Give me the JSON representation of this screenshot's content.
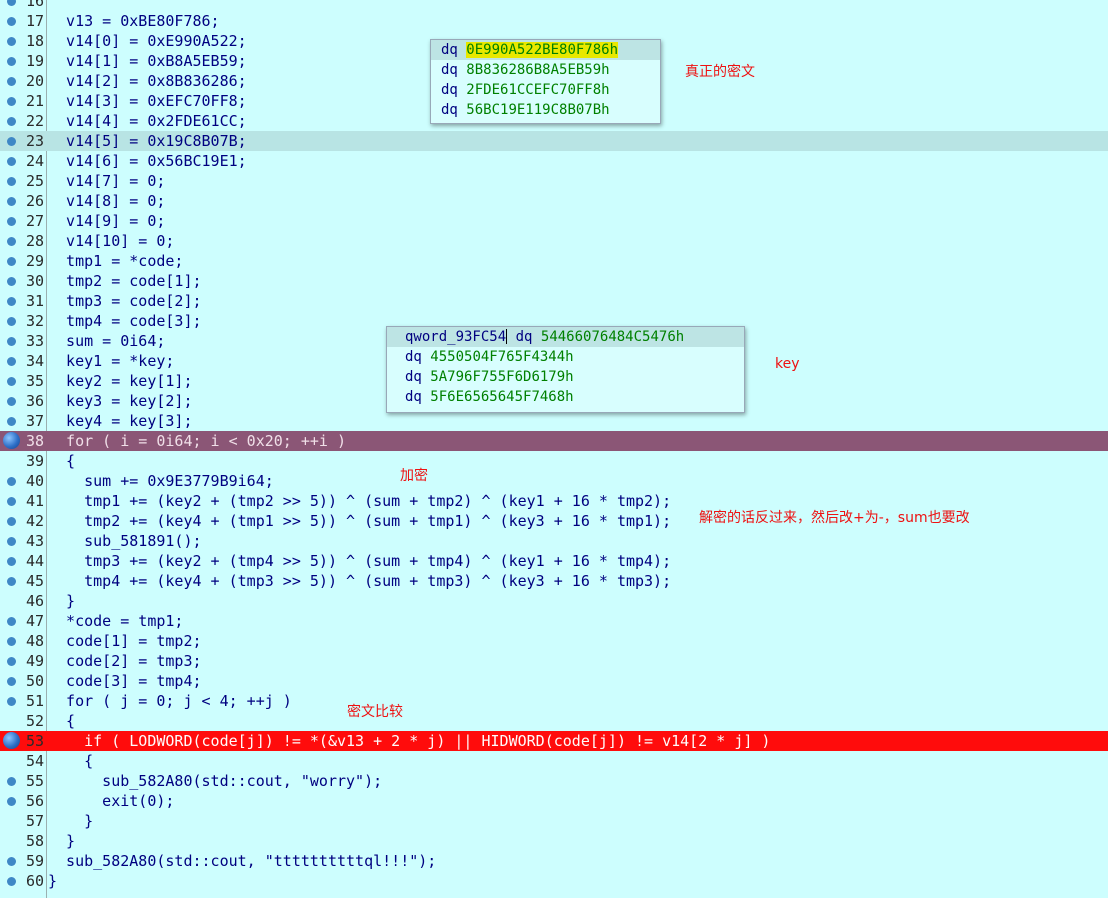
{
  "code_lines": [
    {
      "no": "16",
      "text": "",
      "marker": "dot",
      "hl": ""
    },
    {
      "no": "17",
      "text": "  v13 = 0xBE80F786;",
      "marker": "dot",
      "hl": ""
    },
    {
      "no": "18",
      "text": "  v14[0] = 0xE990A522;",
      "marker": "dot",
      "hl": ""
    },
    {
      "no": "19",
      "text": "  v14[1] = 0xB8A5EB59;",
      "marker": "dot",
      "hl": ""
    },
    {
      "no": "20",
      "text": "  v14[2] = 0x8B836286;",
      "marker": "dot",
      "hl": ""
    },
    {
      "no": "21",
      "text": "  v14[3] = 0xEFC70FF8;",
      "marker": "dot",
      "hl": ""
    },
    {
      "no": "22",
      "text": "  v14[4] = 0x2FDE61CC;",
      "marker": "dot",
      "hl": ""
    },
    {
      "no": "23",
      "text": "  v14[5] = 0x19C8B07B;",
      "marker": "dot",
      "hl": "cur"
    },
    {
      "no": "24",
      "text": "  v14[6] = 0x56BC19E1;",
      "marker": "dot",
      "hl": ""
    },
    {
      "no": "25",
      "text": "  v14[7] = 0;",
      "marker": "dot",
      "hl": ""
    },
    {
      "no": "26",
      "text": "  v14[8] = 0;",
      "marker": "dot",
      "hl": ""
    },
    {
      "no": "27",
      "text": "  v14[9] = 0;",
      "marker": "dot",
      "hl": ""
    },
    {
      "no": "28",
      "text": "  v14[10] = 0;",
      "marker": "dot",
      "hl": ""
    },
    {
      "no": "29",
      "text": "  tmp1 = *code;",
      "marker": "dot",
      "hl": ""
    },
    {
      "no": "30",
      "text": "  tmp2 = code[1];",
      "marker": "dot",
      "hl": ""
    },
    {
      "no": "31",
      "text": "  tmp3 = code[2];",
      "marker": "dot",
      "hl": ""
    },
    {
      "no": "32",
      "text": "  tmp4 = code[3];",
      "marker": "dot",
      "hl": ""
    },
    {
      "no": "33",
      "text": "  sum = 0i64;",
      "marker": "dot",
      "hl": ""
    },
    {
      "no": "34",
      "text": "  key1 = *key;",
      "marker": "dot",
      "hl": ""
    },
    {
      "no": "35",
      "text": "  key2 = key[1];",
      "marker": "dot",
      "hl": ""
    },
    {
      "no": "36",
      "text": "  key3 = key[2];",
      "marker": "dot",
      "hl": ""
    },
    {
      "no": "37",
      "text": "  key4 = key[3];",
      "marker": "dot",
      "hl": ""
    },
    {
      "no": "38",
      "text": "  for ( i = 0i64; i < 0x20; ++i )",
      "marker": "bp",
      "hl": "bp1"
    },
    {
      "no": "39",
      "text": "  {",
      "marker": "",
      "hl": ""
    },
    {
      "no": "40",
      "text": "    sum += 0x9E3779B9i64;",
      "marker": "dot",
      "hl": ""
    },
    {
      "no": "41",
      "text": "    tmp1 += (key2 + (tmp2 >> 5)) ^ (sum + tmp2) ^ (key1 + 16 * tmp2);",
      "marker": "dot",
      "hl": ""
    },
    {
      "no": "42",
      "text": "    tmp2 += (key4 + (tmp1 >> 5)) ^ (sum + tmp1) ^ (key3 + 16 * tmp1);",
      "marker": "dot",
      "hl": ""
    },
    {
      "no": "43",
      "text": "    sub_581891();",
      "marker": "dot",
      "hl": ""
    },
    {
      "no": "44",
      "text": "    tmp3 += (key2 + (tmp4 >> 5)) ^ (sum + tmp4) ^ (key1 + 16 * tmp4);",
      "marker": "dot",
      "hl": ""
    },
    {
      "no": "45",
      "text": "    tmp4 += (key4 + (tmp3 >> 5)) ^ (sum + tmp3) ^ (key3 + 16 * tmp3);",
      "marker": "dot",
      "hl": ""
    },
    {
      "no": "46",
      "text": "  }",
      "marker": "",
      "hl": ""
    },
    {
      "no": "47",
      "text": "  *code = tmp1;",
      "marker": "dot",
      "hl": ""
    },
    {
      "no": "48",
      "text": "  code[1] = tmp2;",
      "marker": "dot",
      "hl": ""
    },
    {
      "no": "49",
      "text": "  code[2] = tmp3;",
      "marker": "dot",
      "hl": ""
    },
    {
      "no": "50",
      "text": "  code[3] = tmp4;",
      "marker": "dot",
      "hl": ""
    },
    {
      "no": "51",
      "text": "  for ( j = 0; j < 4; ++j )",
      "marker": "dot",
      "hl": ""
    },
    {
      "no": "52",
      "text": "  {",
      "marker": "",
      "hl": ""
    },
    {
      "no": "53",
      "text": "    if ( LODWORD(code[j]) != *(&v13 + 2 * j) || HIDWORD(code[j]) != v14[2 * j] )",
      "marker": "bp",
      "hl": "bp2"
    },
    {
      "no": "54",
      "text": "    {",
      "marker": "",
      "hl": ""
    },
    {
      "no": "55",
      "text": "      sub_582A80(std::cout, \"worry\");",
      "marker": "dot",
      "hl": ""
    },
    {
      "no": "56",
      "text": "      exit(0);",
      "marker": "dot",
      "hl": ""
    },
    {
      "no": "57",
      "text": "    }",
      "marker": "",
      "hl": ""
    },
    {
      "no": "58",
      "text": "  }",
      "marker": "",
      "hl": ""
    },
    {
      "no": "59",
      "text": "  sub_582A80(std::cout, \"ttttttttttql!!!\");",
      "marker": "dot",
      "hl": ""
    },
    {
      "no": "60",
      "text": "}",
      "marker": "dot",
      "hl": ""
    }
  ],
  "popup_cipher": {
    "rows": [
      {
        "dir": "dq",
        "val": "0E990A522BE80F786h"
      },
      {
        "dir": "dq",
        "val": "8B836286B8A5EB59h"
      },
      {
        "dir": "dq",
        "val": "2FDE61CCEFC70FF8h"
      },
      {
        "dir": "dq",
        "val": "56BC19E119C8B07Bh"
      }
    ]
  },
  "popup_key": {
    "label": "qword_93FC54",
    "rows": [
      {
        "dir": "dq",
        "val": "54466076484C5476h"
      },
      {
        "dir": "dq",
        "val": "4550504F765F4344h"
      },
      {
        "dir": "dq",
        "val": "5A796F755F6D6179h"
      },
      {
        "dir": "dq",
        "val": "5F6E6565645F7468h"
      }
    ]
  },
  "notes": {
    "real_cipher": "真正的密文",
    "key": "key",
    "encrypt": "加密",
    "decrypt_hint": "解密的话反过来，然后改+为-，sum也要改",
    "compare": "密文比较"
  }
}
